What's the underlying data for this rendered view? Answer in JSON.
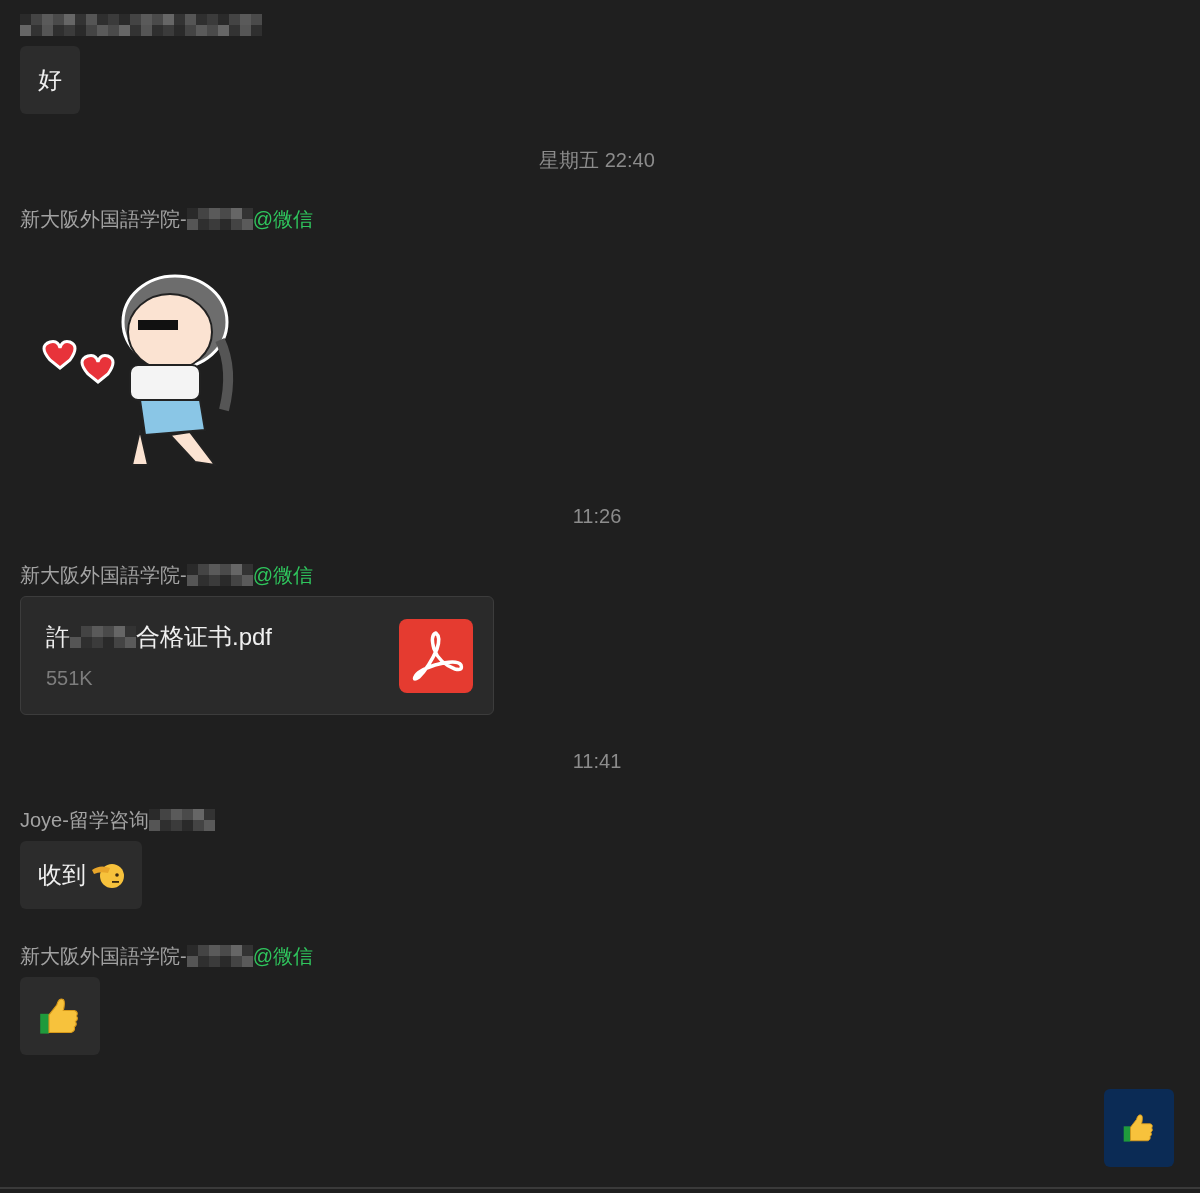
{
  "messages": [
    {
      "kind": "incoming",
      "sender": {
        "redacted": true
      },
      "content": {
        "kind": "text",
        "text": "好"
      }
    },
    {
      "kind": "time",
      "text": "星期五 22:40"
    },
    {
      "kind": "incoming",
      "sender": {
        "prefix": "新大阪外国語学院-",
        "redacted": true,
        "source": "@微信"
      },
      "content": {
        "kind": "sticker"
      }
    },
    {
      "kind": "time",
      "text": "11:26"
    },
    {
      "kind": "incoming",
      "sender": {
        "prefix": "新大阪外国語学院-",
        "redacted": true,
        "source": "@微信"
      },
      "content": {
        "kind": "file",
        "name_start": "許",
        "name_end": "合格证书.pdf",
        "size": "551K"
      }
    },
    {
      "kind": "time",
      "text": "11:41"
    },
    {
      "kind": "incoming",
      "sender": {
        "prefix": "Joye-留学咨询",
        "redacted": true
      },
      "content": {
        "kind": "salute_text",
        "text": "收到"
      }
    },
    {
      "kind": "incoming",
      "sender": {
        "prefix": "新大阪外国語学院-",
        "redacted": true,
        "source": "@微信"
      },
      "content": {
        "kind": "thumbs_up"
      }
    },
    {
      "kind": "outgoing",
      "content": {
        "kind": "thumbs_up"
      }
    }
  ]
}
